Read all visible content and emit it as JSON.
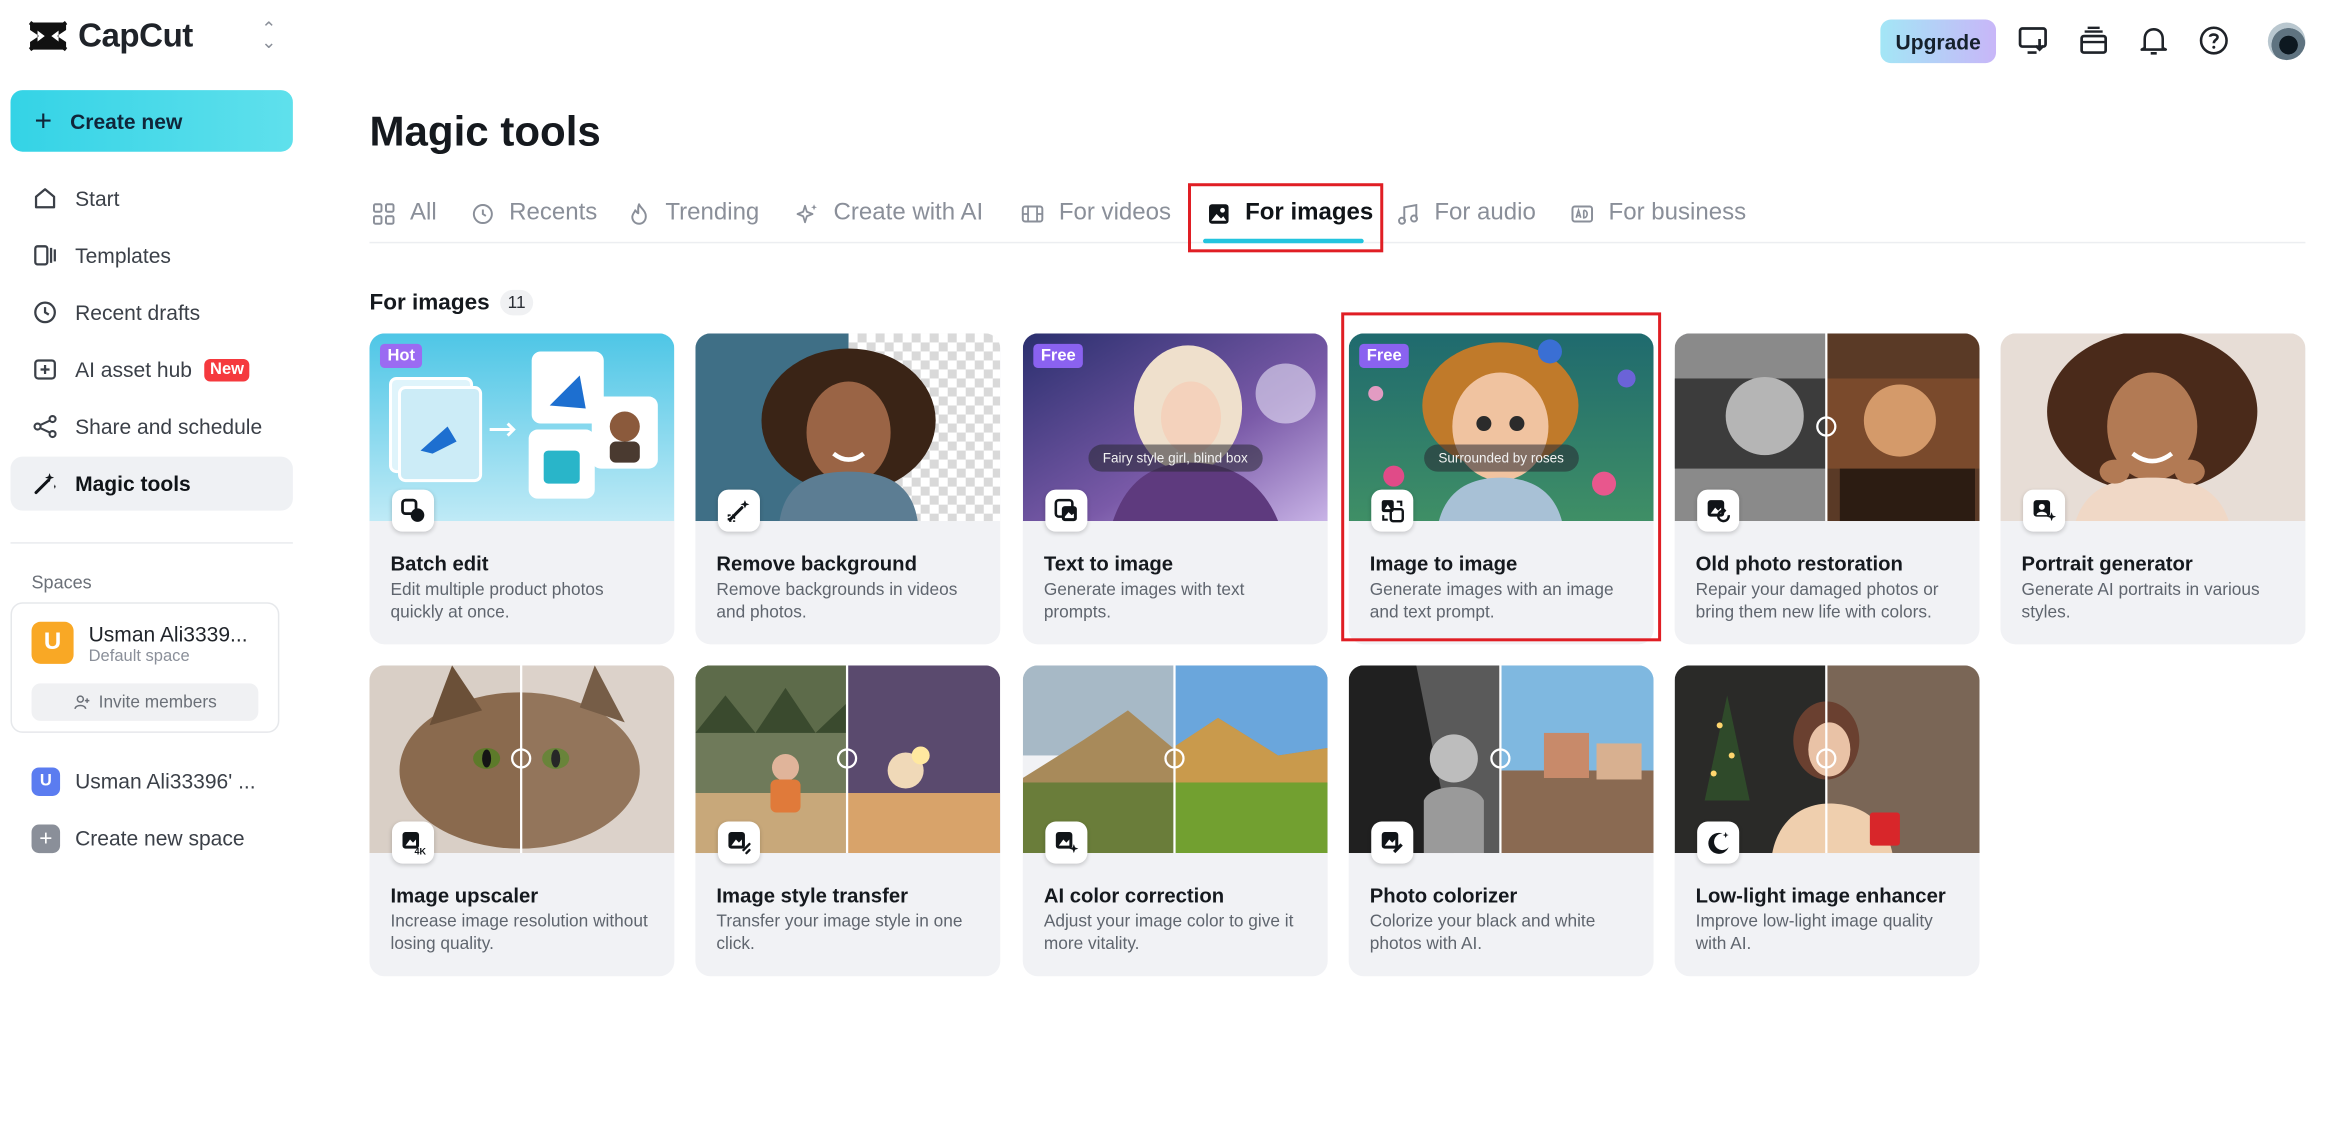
{
  "app": {
    "name": "CapCut"
  },
  "sidebar": {
    "create_label": "Create new",
    "items": [
      {
        "label": "Start",
        "icon": "home-icon"
      },
      {
        "label": "Templates",
        "icon": "templates-icon"
      },
      {
        "label": "Recent drafts",
        "icon": "clock-icon"
      },
      {
        "label": "AI asset hub",
        "icon": "ai-asset-icon",
        "badge": "New"
      },
      {
        "label": "Share and schedule",
        "icon": "share-icon"
      },
      {
        "label": "Magic tools",
        "icon": "magic-wand-icon",
        "active": true
      }
    ],
    "spaces_label": "Spaces",
    "space_card": {
      "avatar": "U",
      "name": "Usman Ali3339...",
      "subtitle": "Default space",
      "invite_label": "Invite members"
    },
    "space_row": {
      "avatar": "U",
      "name": "Usman Ali33396' ..."
    },
    "new_space_label": "Create new space"
  },
  "topbar": {
    "upgrade_label": "Upgrade"
  },
  "main": {
    "title": "Magic tools",
    "tabs": [
      {
        "label": "All",
        "icon": "grid-icon"
      },
      {
        "label": "Recents",
        "icon": "clock-icon"
      },
      {
        "label": "Trending",
        "icon": "flame-icon"
      },
      {
        "label": "Create with AI",
        "icon": "sparkle-icon"
      },
      {
        "label": "For videos",
        "icon": "film-icon"
      },
      {
        "label": "For images",
        "icon": "image-icon",
        "active": true
      },
      {
        "label": "For audio",
        "icon": "music-icon"
      },
      {
        "label": "For business",
        "icon": "ad-icon"
      }
    ],
    "section_title": "For images",
    "section_count": "11",
    "cards": [
      {
        "title": "Batch edit",
        "desc": "Edit multiple product photos quickly at once.",
        "badge": "Hot"
      },
      {
        "title": "Remove background",
        "desc": "Remove backgrounds in videos and photos."
      },
      {
        "title": "Text to image",
        "desc": "Generate images with text prompts.",
        "badge": "Free",
        "caption": "Fairy style girl, blind box"
      },
      {
        "title": "Image to image",
        "desc": "Generate images with an image and text prompt.",
        "badge": "Free",
        "caption": "Surrounded by roses"
      },
      {
        "title": "Old photo restoration",
        "desc": "Repair your damaged photos or bring them new life with colors."
      },
      {
        "title": "Portrait generator",
        "desc": "Generate AI portraits in various styles."
      },
      {
        "title": "Image upscaler",
        "desc": "Increase image resolution without losing quality."
      },
      {
        "title": "Image style transfer",
        "desc": "Transfer your image style in one click."
      },
      {
        "title": "AI color correction",
        "desc": "Adjust your image color to give it more vitality."
      },
      {
        "title": "Photo colorizer",
        "desc": "Colorize your black and white photos with AI."
      },
      {
        "title": "Low-light image enhancer",
        "desc": "Improve low-light image quality with AI."
      }
    ]
  },
  "colors": {
    "accent": "#22c4de",
    "highlight": "#e01e24",
    "badge_new": "#f5393e",
    "badge_free": "#8a62f0"
  }
}
